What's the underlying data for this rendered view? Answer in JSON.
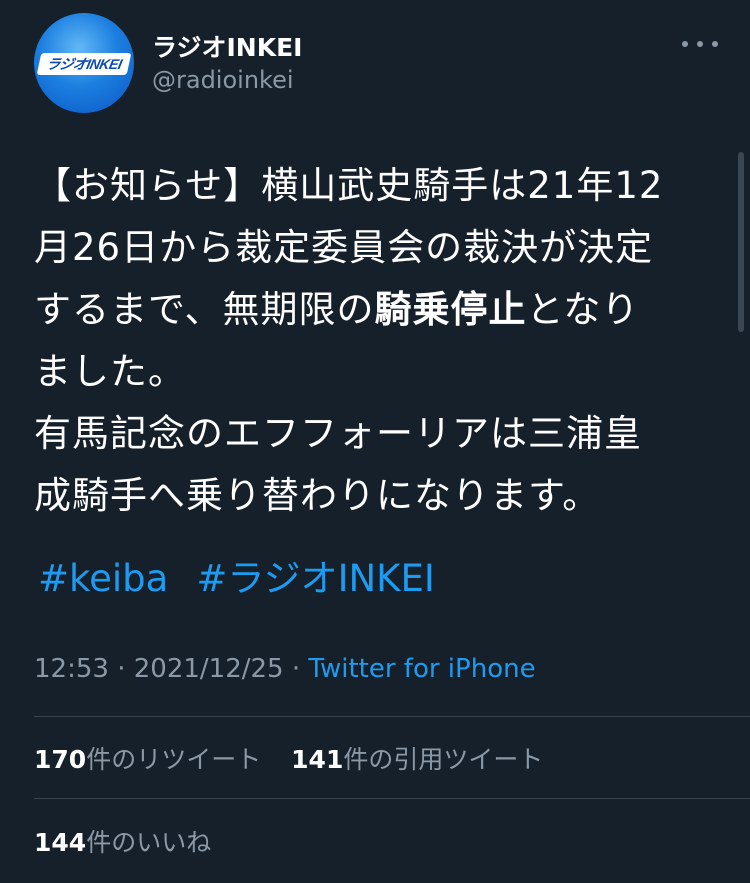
{
  "account": {
    "display_name": "ラジオINKEI",
    "handle": "@radioinkei",
    "avatar_logo_text": "ラジオINKEI"
  },
  "tweet": {
    "lines": [
      {
        "text": "【お知らせ】横山武史騎手は21年12"
      },
      {
        "text": "月26日から裁定委員会の裁決が決定"
      },
      {
        "pre": "するまで、無期限の",
        "bold": "騎乗停止",
        "post": "となり"
      },
      {
        "text": "ました。"
      },
      {
        "text": "有馬記念のエフフォーリアは三浦皇"
      },
      {
        "text": "成騎手へ乗り替わりになります。"
      }
    ],
    "hashtags": [
      "#keiba",
      "#ラジオINKEI"
    ]
  },
  "meta": {
    "time": "12:53",
    "separator": "·",
    "date": "2021/12/25",
    "source": "Twitter for iPhone"
  },
  "stats": {
    "retweets_count": "170",
    "retweets_label": "件のリツイート",
    "quotes_count": "141",
    "quotes_label": "件の引用ツイート",
    "likes_count": "144",
    "likes_label": "件のいいね"
  },
  "icons": {
    "more": "more-dots-icon"
  },
  "colors": {
    "background": "#15202b",
    "link": "#1d9bf0",
    "secondary_text": "#8b98a5",
    "divider": "#38444d"
  }
}
